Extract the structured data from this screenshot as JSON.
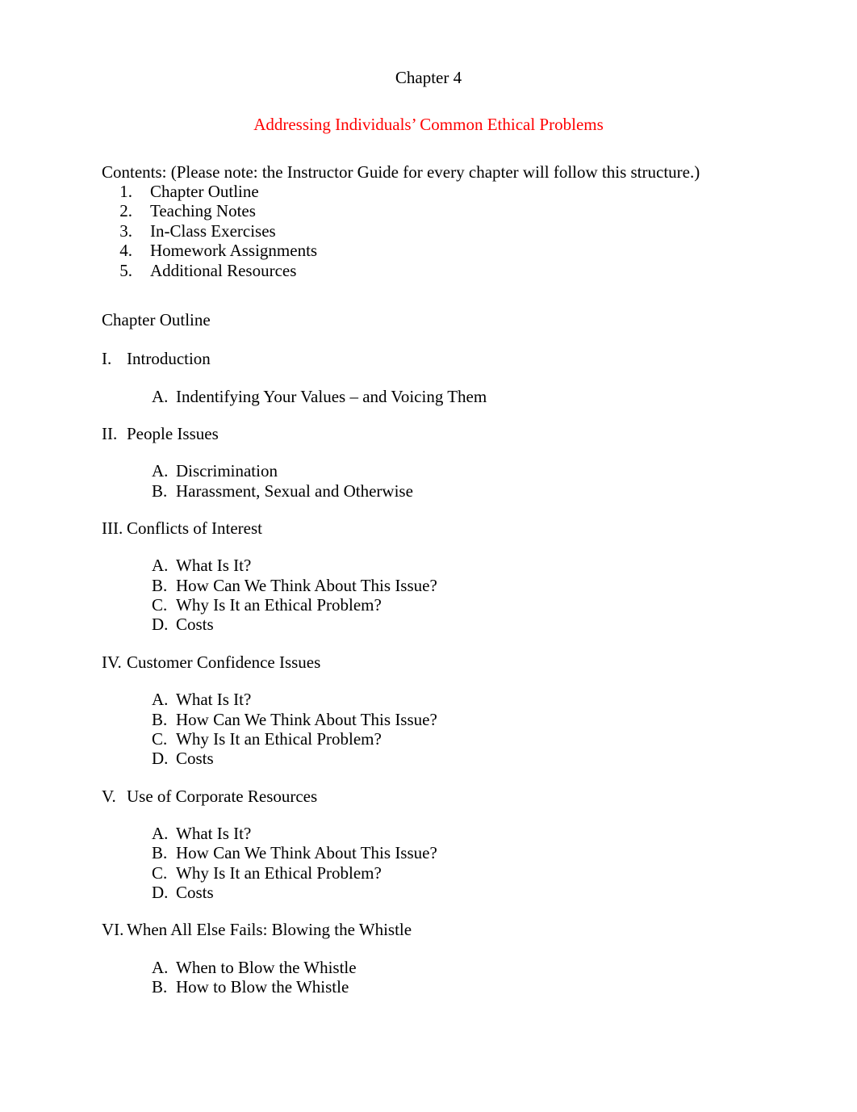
{
  "document": {
    "chapter_heading": "Chapter 4",
    "chapter_title": "Addressing Individuals’ Common Ethical Problems",
    "title_color": "#ff0000",
    "contents_line": "Contents:  (Please note: the Instructor Guide for every chapter will follow this structure.)",
    "contents_list": [
      {
        "num": "1.",
        "text": "Chapter Outline"
      },
      {
        "num": "2.",
        "text": "Teaching Notes"
      },
      {
        "num": "3.",
        "text": "In-Class Exercises"
      },
      {
        "num": "4.",
        "text": "Homework Assignments"
      },
      {
        "num": "5.",
        "text": "Additional Resources"
      }
    ],
    "section_label": "Chapter Outline",
    "outline": [
      {
        "numeral": "I.",
        "title": "Introduction",
        "subitems": [
          {
            "letter": "A.",
            "text": "Indentifying Your Values – and Voicing Them"
          }
        ]
      },
      {
        "numeral": "II.",
        "title": "People Issues",
        "subitems": [
          {
            "letter": "A.",
            "text": "Discrimination"
          },
          {
            "letter": "B.",
            "text": "Harassment, Sexual and Otherwise"
          }
        ]
      },
      {
        "numeral": "III.",
        "title": "Conflicts of Interest",
        "subitems": [
          {
            "letter": "A.",
            "text": "What Is It?"
          },
          {
            "letter": "B.",
            "text": "How Can We Think About This Issue?"
          },
          {
            "letter": "C.",
            "text": "Why Is It an Ethical Problem?"
          },
          {
            "letter": "D.",
            "text": "Costs"
          }
        ]
      },
      {
        "numeral": "IV.",
        "title": "Customer Confidence Issues",
        "subitems": [
          {
            "letter": "A.",
            "text": "What Is It?"
          },
          {
            "letter": "B.",
            "text": "How Can We Think About This Issue?"
          },
          {
            "letter": "C.",
            "text": "Why Is It an Ethical Problem?"
          },
          {
            "letter": "D.",
            "text": "Costs"
          }
        ]
      },
      {
        "numeral": "V.",
        "title": "Use of Corporate Resources",
        "subitems": [
          {
            "letter": "A.",
            "text": "What Is It?"
          },
          {
            "letter": "B.",
            "text": "How Can We Think About This Issue?"
          },
          {
            "letter": "C.",
            "text": "Why Is It an Ethical Problem?"
          },
          {
            "letter": "D.",
            "text": "Costs"
          }
        ]
      },
      {
        "numeral": "VI.",
        "title": "When All Else Fails: Blowing the Whistle",
        "subitems": [
          {
            "letter": "A.",
            "text": "When to Blow the Whistle"
          },
          {
            "letter": "B.",
            "text": "How to Blow the Whistle"
          }
        ]
      }
    ]
  }
}
